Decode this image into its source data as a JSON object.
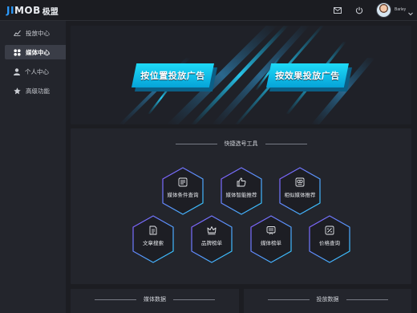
{
  "header": {
    "logo_text_latin": "MOB",
    "logo_text_j": "JI",
    "logo_text_cn": "极盟",
    "username": "Barley",
    "icons": {
      "mail": "mail-icon",
      "power": "power-icon",
      "caret": "chevron-down-icon"
    }
  },
  "sidebar": {
    "items": [
      {
        "label": "投放中心",
        "icon": "chart-icon",
        "active": false
      },
      {
        "label": "媒体中心",
        "icon": "grid-icon",
        "active": true
      },
      {
        "label": "个人中心",
        "icon": "user-icon",
        "active": false
      },
      {
        "label": "高级功能",
        "icon": "star-icon",
        "active": false
      }
    ]
  },
  "banner": {
    "left_button": "按位置投放广告",
    "right_button": "按效果投放广告"
  },
  "tools": {
    "title": "快捷选号工具",
    "row1": [
      {
        "label": "媒体条件查询",
        "icon": "list-icon"
      },
      {
        "label": "媒体智能推荐",
        "icon": "thumb-up-icon"
      },
      {
        "label": "相似媒体推荐",
        "icon": "compare-icon"
      }
    ],
    "row2": [
      {
        "label": "文章搜索",
        "icon": "document-icon"
      },
      {
        "label": "品牌榜单",
        "icon": "crown-icon"
      },
      {
        "label": "媒体榜单",
        "icon": "media-icon"
      },
      {
        "label": "价格查询",
        "icon": "tag-icon"
      }
    ]
  },
  "bottom": {
    "left_title": "媒体数据",
    "right_title": "投放数据"
  },
  "colors": {
    "accent": "#1edaf7",
    "hex_border_from": "#8a55ff",
    "hex_border_to": "#2fd0ff"
  }
}
